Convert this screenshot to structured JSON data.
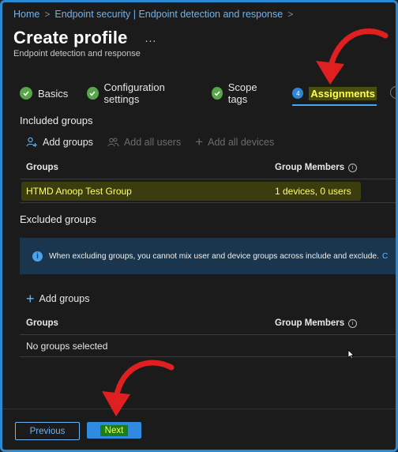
{
  "breadcrumb": {
    "items": [
      "Home",
      "Endpoint security | Endpoint detection and response"
    ]
  },
  "header": {
    "title": "Create profile",
    "more": "...",
    "subtitle": "Endpoint detection and response"
  },
  "wizard": {
    "tabs": [
      {
        "label": "Basics",
        "state": "complete"
      },
      {
        "label": "Configuration settings",
        "state": "complete"
      },
      {
        "label": "Scope tags",
        "state": "complete"
      },
      {
        "label": "Assignments",
        "state": "active",
        "step": "4"
      }
    ]
  },
  "included": {
    "title": "Included groups",
    "commands": {
      "add_groups": "Add groups",
      "add_all_users": "Add all users",
      "add_all_devices": "Add all devices"
    },
    "columns": {
      "groups": "Groups",
      "members": "Group Members"
    },
    "rows": [
      {
        "group": "HTMD Anoop Test Group",
        "members": "1 devices, 0 users"
      }
    ]
  },
  "excluded": {
    "title": "Excluded groups",
    "banner": {
      "text": "When excluding groups, you cannot mix user and device groups across include and exclude.",
      "link": "C"
    },
    "commands": {
      "add_groups": "Add groups"
    },
    "columns": {
      "groups": "Groups",
      "members": "Group Members"
    },
    "empty": "No groups selected"
  },
  "footer": {
    "previous": "Previous",
    "next": "Next"
  },
  "colors": {
    "accent": "#2f8ae0",
    "success": "#57a64a",
    "highlight": "#ffff55",
    "annotation": "#e02020"
  }
}
